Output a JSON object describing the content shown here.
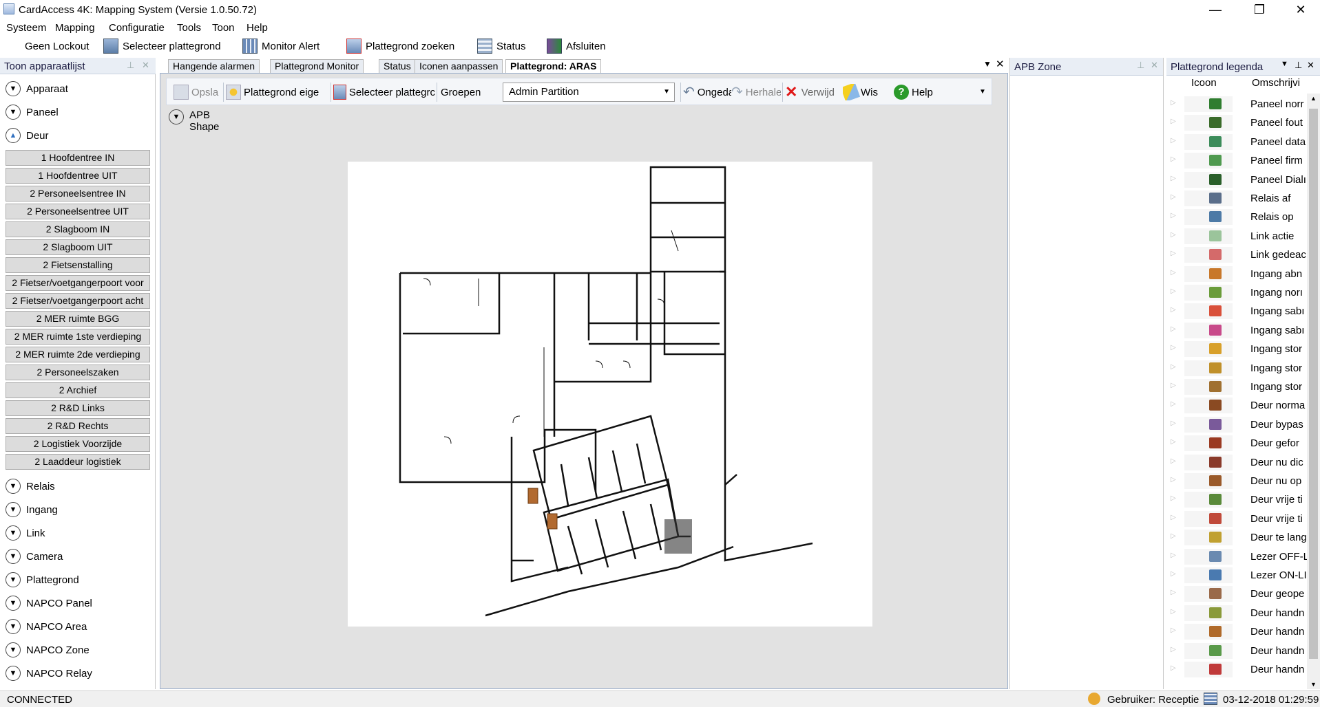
{
  "window": {
    "title": "CardAccess 4K: Mapping System (Versie 1.0.50.72)",
    "minimize": "—",
    "maximize": "❐",
    "close": "✕"
  },
  "menu": [
    "Systeem",
    "Mapping",
    "Configuratie",
    "Tools",
    "Toon",
    "Help"
  ],
  "toolbar": {
    "geen_lockout": "Geen Lockout",
    "selecteer": "Selecteer plattegrond",
    "monitor": "Monitor Alert",
    "zoeken": "Plattegrond zoeken",
    "status": "Status",
    "afsluiten": "Afsluiten"
  },
  "left_panel": {
    "title": "Toon apparaatlijst",
    "categories_top": [
      "Apparaat",
      "Paneel"
    ],
    "deur_label": "Deur",
    "doors": [
      "1 Hoofdentree IN",
      "1 Hoofdentree UIT",
      "2 Personeelsentree IN",
      "2 Personeelsentree UIT",
      "2 Slagboom IN",
      "2 Slagboom UIT",
      "2 Fietsenstalling",
      "2 Fietser/voetgangerpoort voor",
      "2 Fietser/voetgangerpoort acht",
      "2 MER ruimte BGG",
      "2 MER ruimte 1ste verdieping",
      "2 MER ruimte 2de verdieping",
      "2 Personeelszaken",
      "2 Archief",
      "2 R&D Links",
      "2 R&D Rechts",
      "2 Logistiek Voorzijde",
      "2 Laaddeur logistiek"
    ],
    "categories_bottom": [
      "Relais",
      "Ingang",
      "Link",
      "Camera",
      "Plattegrond",
      "NAPCO Panel",
      "NAPCO Area",
      "NAPCO Zone",
      "NAPCO Relay"
    ]
  },
  "tabs": [
    "Hangende alarmen",
    "Plattegrond Monitor",
    "Status",
    "Iconen aanpassen",
    "Plattegrond: ARAS"
  ],
  "doc_toolbar": {
    "opslaan": "Opsla",
    "eigenschappen": "Plattegrond eige",
    "selecteer": "Selecteer plattegrc",
    "groepen_label": "Groepen",
    "groepen_value": "Admin Partition",
    "ongedaan": "Ongeda",
    "herhalen": "Herhale",
    "verwijderen": "Verwijd",
    "wis": "Wis",
    "help": "Help"
  },
  "apb_shape": {
    "line1": "APB",
    "line2": "Shape"
  },
  "apb_zone": {
    "title": "APB Zone"
  },
  "legend": {
    "title": "Plattegrond legenda",
    "col_icon": "Icoon",
    "col_desc": "Omschrijvi",
    "items": [
      {
        "label": "Paneel norr",
        "color": "#2f7d2f"
      },
      {
        "label": "Paneel fout",
        "color": "#3a6b2a"
      },
      {
        "label": "Paneel data",
        "color": "#3c8c5a"
      },
      {
        "label": "Paneel firm",
        "color": "#4f9a4f"
      },
      {
        "label": "Paneel Dialı",
        "color": "#2a5f2a"
      },
      {
        "label": "Relais af",
        "color": "#5a6e8a"
      },
      {
        "label": "Relais op",
        "color": "#4d7aa6"
      },
      {
        "label": "Link actie",
        "color": "#9bc49b"
      },
      {
        "label": "Link gedeac",
        "color": "#d46a6a"
      },
      {
        "label": "Ingang abn",
        "color": "#c8782a"
      },
      {
        "label": "Ingang norı",
        "color": "#6a9c3a"
      },
      {
        "label": "Ingang sabı",
        "color": "#d9503a"
      },
      {
        "label": "Ingang sabı",
        "color": "#c84a8a"
      },
      {
        "label": "Ingang stor",
        "color": "#d8a02a"
      },
      {
        "label": "Ingang stor",
        "color": "#c0902a"
      },
      {
        "label": "Ingang stor",
        "color": "#a07030"
      },
      {
        "label": "Deur norma",
        "color": "#8a4a22"
      },
      {
        "label": "Deur bypas",
        "color": "#7a5a9a"
      },
      {
        "label": "Deur gefor",
        "color": "#9a3a22"
      },
      {
        "label": "Deur nu dic",
        "color": "#8a3a2a"
      },
      {
        "label": "Deur nu op",
        "color": "#9a5a2a"
      },
      {
        "label": "Deur vrije ti",
        "color": "#5a8a3a"
      },
      {
        "label": "Deur vrije ti",
        "color": "#c04a3a"
      },
      {
        "label": "Deur te lang",
        "color": "#c0a030"
      },
      {
        "label": "Lezer OFF-L",
        "color": "#6a8ab0"
      },
      {
        "label": "Lezer ON-LI",
        "color": "#4a7ab0"
      },
      {
        "label": "Deur geope",
        "color": "#9a6a4a"
      },
      {
        "label": "Deur handn",
        "color": "#8a9a3a"
      },
      {
        "label": "Deur handn",
        "color": "#b06a2a"
      },
      {
        "label": "Deur handn",
        "color": "#5a9a4a"
      },
      {
        "label": "Deur handn",
        "color": "#c03a3a"
      }
    ]
  },
  "statusbar": {
    "connection": "CONNECTED",
    "user": "Gebruiker: Receptie",
    "datetime": "03-12-2018 01:29:59"
  }
}
